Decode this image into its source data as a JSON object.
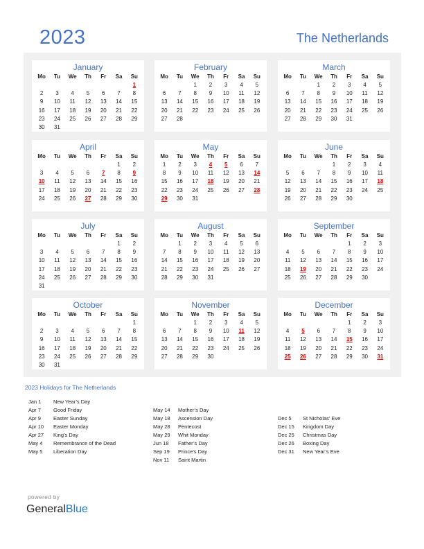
{
  "header": {
    "year": "2023",
    "country": "The Netherlands"
  },
  "weekdays": [
    "Mo",
    "Tu",
    "We",
    "Th",
    "Fr",
    "Sa",
    "Su"
  ],
  "colors": {
    "accent": "#4472c4",
    "holiday": "#e00000",
    "panel_bg": "#f0f0f0",
    "brand_blue": "#1f7ac4"
  },
  "months": [
    {
      "name": "January",
      "offset": 6,
      "days": 31,
      "holidays": [
        1
      ]
    },
    {
      "name": "February",
      "offset": 2,
      "days": 28,
      "holidays": []
    },
    {
      "name": "March",
      "offset": 2,
      "days": 31,
      "holidays": []
    },
    {
      "name": "April",
      "offset": 5,
      "days": 30,
      "holidays": [
        7,
        9,
        10,
        27
      ]
    },
    {
      "name": "May",
      "offset": 0,
      "days": 31,
      "holidays": [
        4,
        5,
        14,
        18,
        28,
        29
      ]
    },
    {
      "name": "June",
      "offset": 3,
      "days": 30,
      "holidays": [
        18
      ]
    },
    {
      "name": "July",
      "offset": 5,
      "days": 31,
      "holidays": []
    },
    {
      "name": "August",
      "offset": 1,
      "days": 31,
      "holidays": []
    },
    {
      "name": "September",
      "offset": 4,
      "days": 30,
      "holidays": [
        19
      ]
    },
    {
      "name": "October",
      "offset": 6,
      "days": 31,
      "holidays": []
    },
    {
      "name": "November",
      "offset": 2,
      "days": 30,
      "holidays": [
        11
      ]
    },
    {
      "name": "December",
      "offset": 4,
      "days": 31,
      "holidays": [
        5,
        15,
        25,
        26,
        31
      ]
    }
  ],
  "holidays_title": "2023 Holidays for The Netherlands",
  "holiday_columns": [
    [
      {
        "date": "Jan 1",
        "name": "New Year’s Day"
      },
      {
        "date": "Apr 7",
        "name": "Good Friday"
      },
      {
        "date": "Apr 9",
        "name": "Easter Sunday"
      },
      {
        "date": "Apr 10",
        "name": "Easter Monday"
      },
      {
        "date": "Apr 27",
        "name": "King’s Day"
      },
      {
        "date": "May 4",
        "name": "Remembrance of the Dead"
      },
      {
        "date": "May 5",
        "name": "Liberation Day"
      }
    ],
    [
      {
        "date": "May 14",
        "name": "Mother’s Day"
      },
      {
        "date": "May 18",
        "name": "Ascension Day"
      },
      {
        "date": "May 28",
        "name": "Pentecost"
      },
      {
        "date": "May 29",
        "name": "Whit Monday"
      },
      {
        "date": "Jun 18",
        "name": "Father’s Day"
      },
      {
        "date": "Sep 19",
        "name": "Prince’s Day"
      },
      {
        "date": "Nov 11",
        "name": "Saint Martin"
      }
    ],
    [
      {
        "date": "Dec 5",
        "name": "St Nicholas’ Eve"
      },
      {
        "date": "Dec 15",
        "name": "Kingdom Day"
      },
      {
        "date": "Dec 25",
        "name": "Christmas Day"
      },
      {
        "date": "Dec 26",
        "name": "Boxing Day"
      },
      {
        "date": "Dec 31",
        "name": "New Year’s Eve"
      }
    ]
  ],
  "footer": {
    "powered_by": "powered by",
    "brand_general": "General",
    "brand_blue": "Blue"
  }
}
